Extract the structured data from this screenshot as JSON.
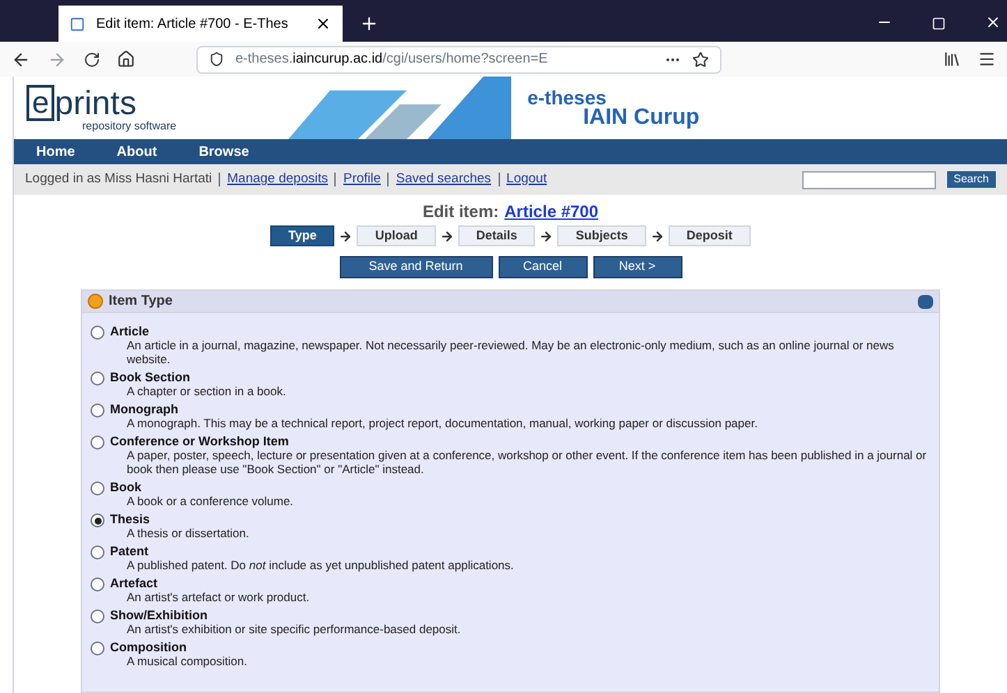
{
  "browser": {
    "tab_title": "Edit item: Article #700 - E-Thes",
    "url_prefix": "e-theses.",
    "url_domain": "iaincurup.ac.id",
    "url_path": "/cgi/users/home?screen=E"
  },
  "banner": {
    "logo_e": "e",
    "logo_rest": "prints",
    "logo_sub": "repository software",
    "site_line1": "e-theses",
    "site_line2": "IAIN Curup"
  },
  "nav": [
    "Home",
    "About",
    "Browse"
  ],
  "login_text": "Logged in as Miss Hasni Hartati",
  "user_links": [
    "Manage deposits",
    "Profile",
    "Saved searches",
    "Logout"
  ],
  "search_button": "Search",
  "title_prefix": "Edit item:",
  "title_link": "Article #700",
  "steps": [
    {
      "label": "Type",
      "selected": true
    },
    {
      "label": "Upload",
      "selected": false
    },
    {
      "label": "Details",
      "selected": false
    },
    {
      "label": "Subjects",
      "selected": false
    },
    {
      "label": "Deposit",
      "selected": false
    }
  ],
  "actions": [
    "Save and Return",
    "Cancel",
    "Next >"
  ],
  "panel_title": "Item Type",
  "types": [
    {
      "name": "Article",
      "description": "An article in a journal, magazine, newspaper. Not necessarily peer-reviewed. May be an electronic-only medium, such as an online journal or news website.",
      "selected": false
    },
    {
      "name": "Book Section",
      "description": "A chapter or section in a book.",
      "selected": false
    },
    {
      "name": "Monograph",
      "description": "A monograph. This may be a technical report, project report, documentation, manual, working paper or discussion paper.",
      "selected": false
    },
    {
      "name": "Conference or Workshop Item",
      "description": "A paper, poster, speech, lecture or presentation given at a conference, workshop or other event. If the conference item has been published in a journal or book then please use \"Book Section\" or \"Article\" instead.",
      "selected": false
    },
    {
      "name": "Book",
      "description": "A book or a conference volume.",
      "selected": false
    },
    {
      "name": "Thesis",
      "description": "A thesis or dissertation.",
      "selected": true
    },
    {
      "name": "Patent",
      "description": "A published patent. Do *not* include as yet unpublished patent applications.",
      "selected": false
    },
    {
      "name": "Artefact",
      "description": "An artist's artefact or work product.",
      "selected": false
    },
    {
      "name": "Show/Exhibition",
      "description": "An artist's exhibition or site specific performance-based deposit.",
      "selected": false
    },
    {
      "name": "Composition",
      "description": "A musical composition.",
      "selected": false
    }
  ]
}
